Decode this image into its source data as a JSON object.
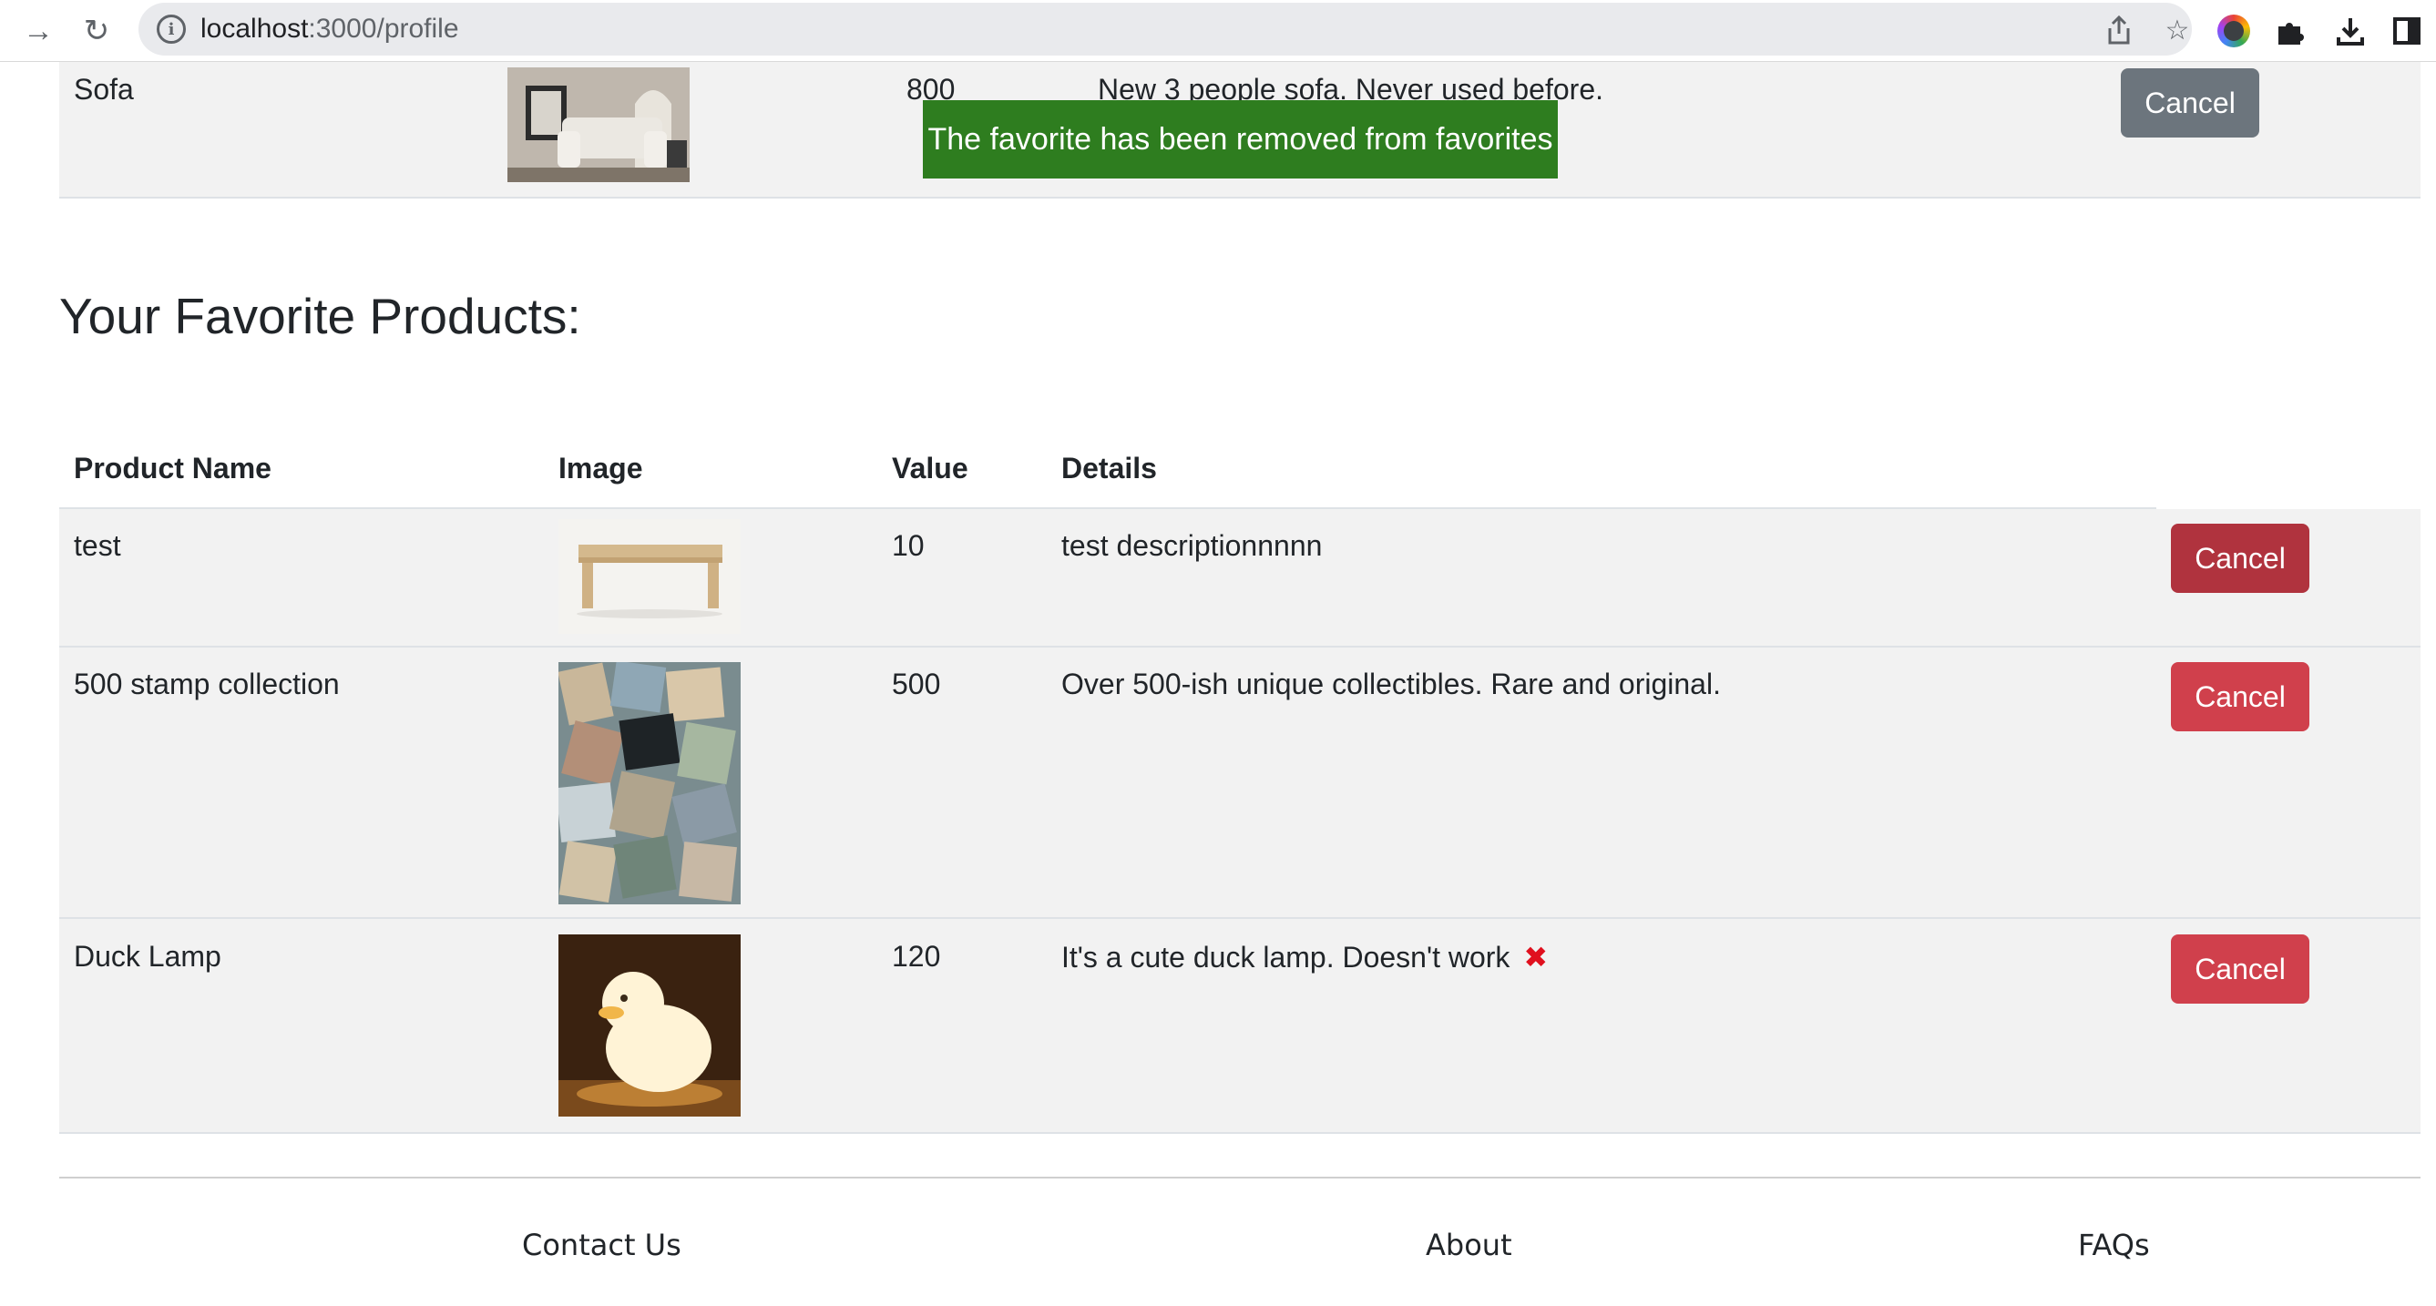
{
  "browser": {
    "url_host": "localhost",
    "url_path": ":3000/profile"
  },
  "top_row": {
    "name": "Sofa",
    "value": "800",
    "details": "New 3 people sofa. Never used before.",
    "button": "Cancel"
  },
  "toast": {
    "message": "The favorite has been removed from favorites",
    "color": "#2e7d1f"
  },
  "favorites": {
    "title": "Your Favorite Products:",
    "columns": [
      "Product Name",
      "Image",
      "Value",
      "Details"
    ],
    "rows": [
      {
        "name": "test",
        "value": "10",
        "details": "test descriptionnnnn",
        "button": "Cancel"
      },
      {
        "name": "500 stamp collection",
        "value": "500",
        "details": "Over 500-ish unique collectibles. Rare and original.",
        "button": "Cancel"
      },
      {
        "name": "Duck Lamp",
        "value": "120",
        "details": "It's a cute duck lamp. Doesn't work",
        "button": "Cancel"
      }
    ]
  },
  "footer": {
    "links": [
      "Contact Us",
      "About",
      "FAQs"
    ]
  },
  "colors": {
    "danger": "#d0404c",
    "secondary": "#6c757d",
    "row_bg": "#f2f2f2"
  }
}
